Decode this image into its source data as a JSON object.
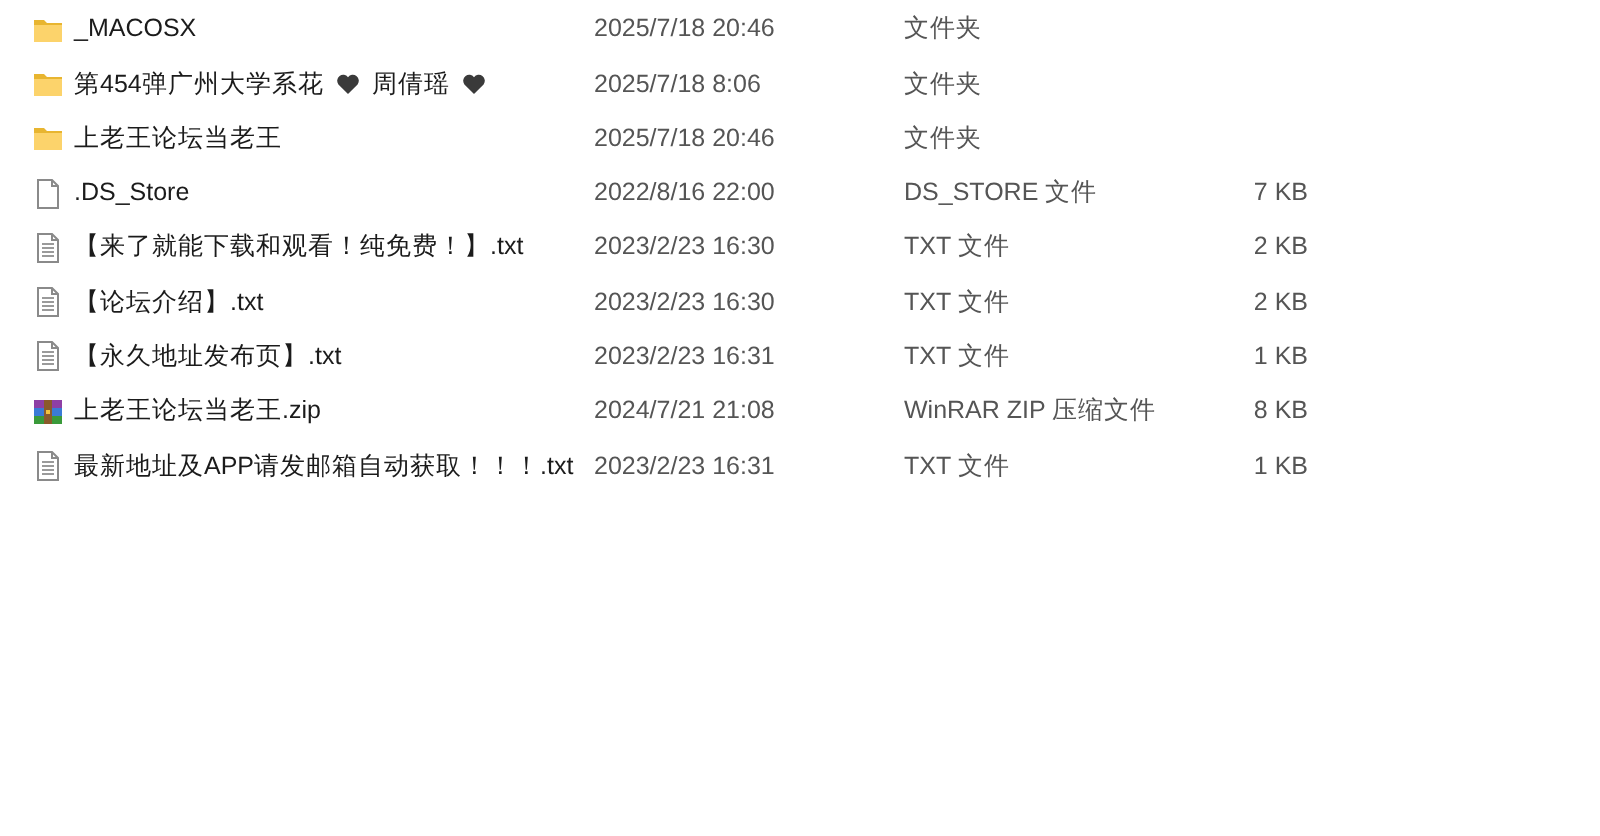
{
  "files": [
    {
      "kind": "folder",
      "name": [
        {
          "kind": "text",
          "text": "_MACOSX"
        }
      ],
      "modified": "2025/7/18 20:46",
      "type": "文件夹"
    },
    {
      "kind": "folder",
      "name": [
        {
          "kind": "text",
          "text": "第454弹广州大学系花"
        },
        {
          "kind": "heart"
        },
        {
          "kind": "text",
          "text": "周倩瑶"
        },
        {
          "kind": "heart"
        }
      ],
      "modified": "2025/7/18 8:06",
      "type": "文件夹"
    },
    {
      "kind": "folder",
      "name": [
        {
          "kind": "text",
          "text": "上老王论坛当老王"
        }
      ],
      "modified": "2025/7/18 20:46",
      "type": "文件夹"
    },
    {
      "kind": "file",
      "name": [
        {
          "kind": "text",
          "text": ".DS_Store"
        }
      ],
      "modified": "2022/8/16 22:00",
      "type": "DS_STORE 文件",
      "size": "7 KB"
    },
    {
      "kind": "text-file",
      "name": [
        {
          "kind": "text",
          "text": "【来了就能下载和观看！纯免费！】.txt"
        }
      ],
      "modified": "2023/2/23 16:30",
      "type": "TXT 文件",
      "size": "2 KB"
    },
    {
      "kind": "text-file",
      "name": [
        {
          "kind": "text",
          "text": "【论坛介绍】.txt"
        }
      ],
      "modified": "2023/2/23 16:30",
      "type": "TXT 文件",
      "size": "2 KB"
    },
    {
      "kind": "text-file",
      "name": [
        {
          "kind": "text",
          "text": "【永久地址发布页】.txt"
        }
      ],
      "modified": "2023/2/23 16:31",
      "type": "TXT 文件",
      "size": "1 KB"
    },
    {
      "kind": "archive",
      "name": [
        {
          "kind": "text",
          "text": "上老王论坛当老王.zip"
        }
      ],
      "modified": "2024/7/21 21:08",
      "type": "WinRAR ZIP 压缩文件",
      "size": "8 KB"
    },
    {
      "kind": "text-file",
      "name": [
        {
          "kind": "text",
          "text": "最新地址及APP请发邮箱自动获取！！！.txt"
        }
      ],
      "modified": "2023/2/23 16:31",
      "type": "TXT 文件",
      "size": "1 KB"
    }
  ]
}
